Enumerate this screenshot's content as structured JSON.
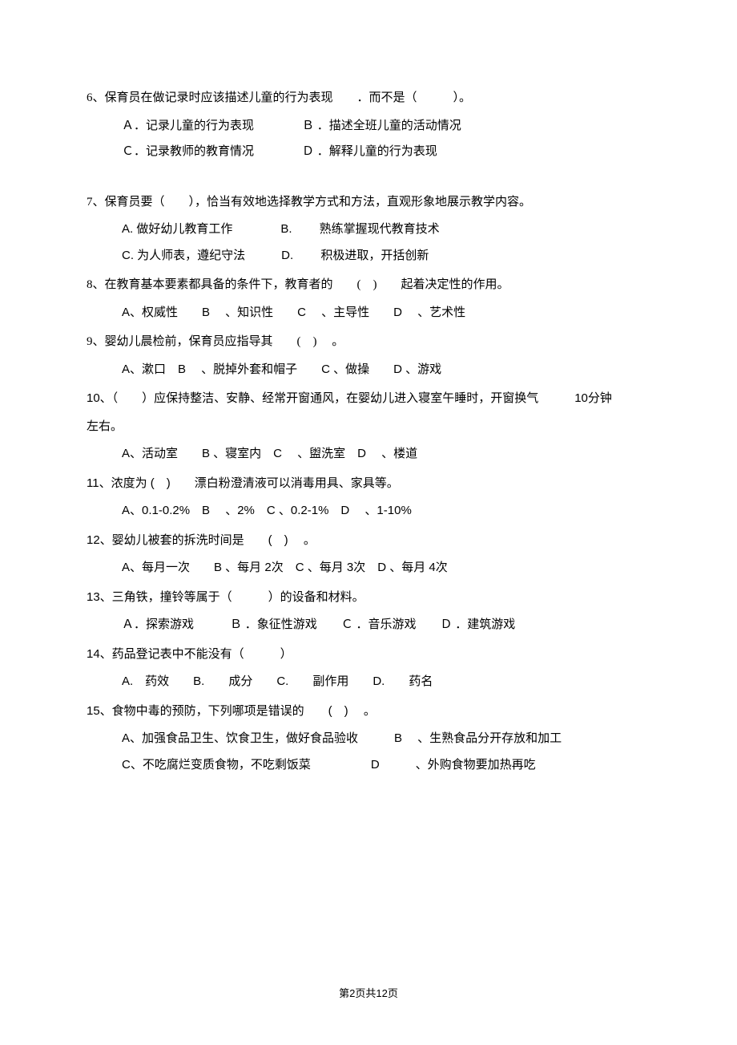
{
  "footer": "第2页共12页",
  "q6": {
    "stem_pre": "6、保育员在做记录时应该描述儿童的行为表现",
    "stem_suf": "．而不是（　　　）。",
    "line1": "Ａ．记录儿童的行为表现　　　　Ｂ ．描述全班儿童的活动情况",
    "line2": "Ｃ．记录教师的教育情况　　　　Ｄ ．解释儿童的行为表现"
  },
  "q7": {
    "stem": "7、保育员要（　　），恰当有效地选择教学方式和方法，直观形象地展示教学内容。",
    "line1": "A. 做好幼儿教育工作　　　　B. 　　熟练掌握现代教育技术",
    "line2": "C. 为人师表，遵纪守法　　　D. 　　积极进取，开括创新"
  },
  "q8": {
    "stem": "8、在教育基本要素都具备的条件下，教育者的　　(　)　　起着决定性的作用。",
    "line1": "A、权威性　　B 　、知识性　　C 　、主导性　　D 　、艺术性"
  },
  "q9": {
    "stem": "9、婴幼儿晨检前，保育员应指导其　　(　) 　。",
    "line1": "A、漱口　B 　、脱掉外套和帽子　　C 、做操　　D 、游戏"
  },
  "q10": {
    "stem1": "10、（　　）应保持整洁、安静、经常开窗通风，在婴幼儿进入寝室午睡时，开窗换气　　　10分钟",
    "stem2": "左右。",
    "line1": "A、活动室　　B 、寝室内　C 　、盥洗室　D 　、楼道"
  },
  "q11": {
    "stem": "11、浓度为 (　)　　漂白粉澄清液可以消毒用具、家具等。",
    "line1": "A、0.1-0.2%　B 　、2%　C 、0.2-1%　D 　、1-10%"
  },
  "q12": {
    "stem": "12、婴幼儿被套的拆洗时间是　　(　) 　。",
    "line1": "A、每月一次　　B 、每月 2次　C 、每月 3次　D 、每月 4次"
  },
  "q13": {
    "stem": "13、三角铁，撞铃等属于（　　　）的设备和材料。",
    "line1": "Ａ．探索游戏　　　Ｂ ．象征性游戏　　Ｃ ．音乐游戏　　Ｄ ．建筑游戏"
  },
  "q14": {
    "stem": "14、药品登记表中不能没有（　　　）",
    "line1": "A.　药效　　B.　　成分　　C.　　副作用　　D.　　药名"
  },
  "q15": {
    "stem": "15、食物中毒的预防，下列哪项是错误的　　(　) 　。",
    "line1": "A、加强食品卫生、饮食卫生，做好食品验收　　　B 　、生熟食品分开存放和加工",
    "line2": "C、不吃腐烂变质食物，不吃剩饭菜　　　　　D　　　、外购食物要加热再吃"
  }
}
